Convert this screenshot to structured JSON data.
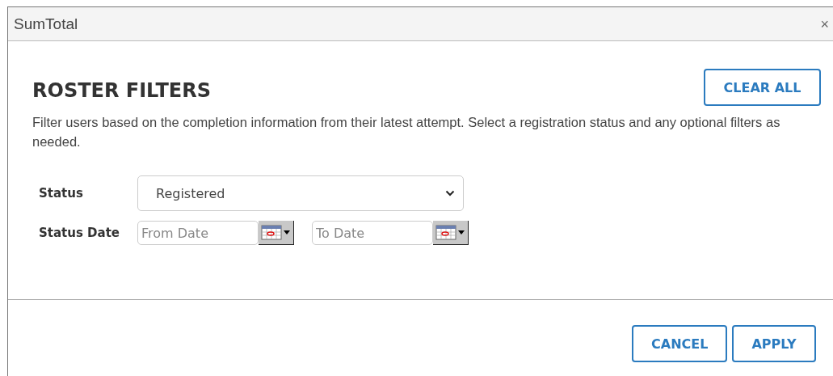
{
  "window": {
    "title": "SumTotal",
    "close": "×"
  },
  "header": {
    "title": "ROSTER FILTERS",
    "clear_button": "CLEAR ALL"
  },
  "description": "Filter users based on the completion information from their latest attempt. Select a registration status and any optional filters as needed.",
  "status": {
    "label": "Status",
    "value": "Registered"
  },
  "status_date": {
    "label": "Status Date",
    "from_placeholder": "From Date",
    "to_placeholder": "To Date"
  },
  "buttons": [
    "CANCEL",
    "APPLY"
  ]
}
